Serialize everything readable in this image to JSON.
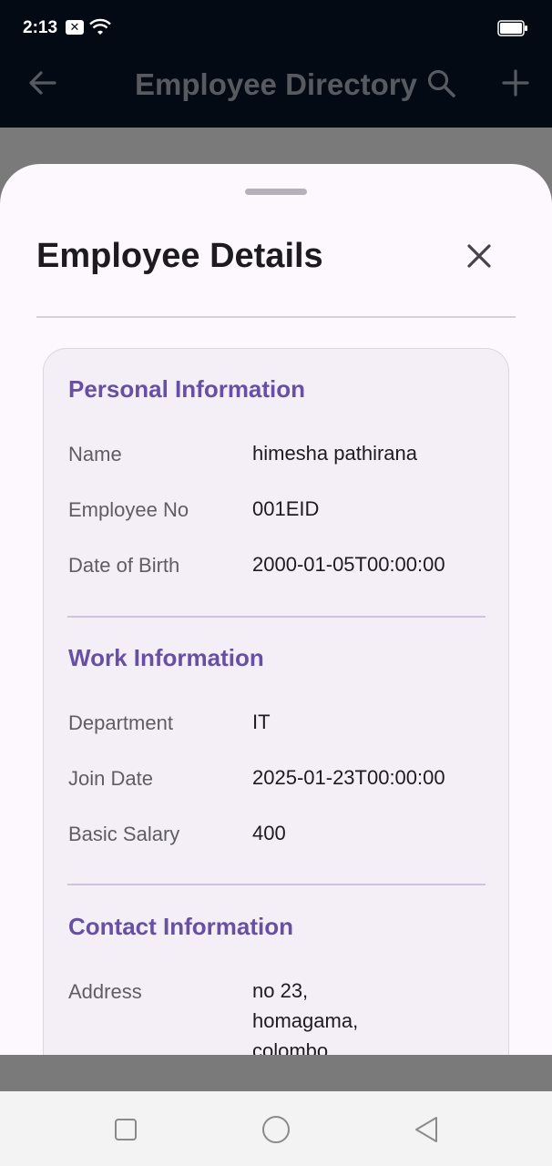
{
  "status_bar": {
    "time": "2:13",
    "notification_glyph": "✕"
  },
  "app_bar": {
    "title": "Employee Directory",
    "back_icon": "arrow-left",
    "search_icon": "search",
    "add_icon": "plus"
  },
  "sheet": {
    "title": "Employee Details",
    "close_icon": "close",
    "sections": [
      {
        "title": "Personal Information",
        "rows": [
          {
            "label": "Name",
            "value": "himesha pathirana"
          },
          {
            "label": "Employee No",
            "value": "001EID"
          },
          {
            "label": "Date of Birth",
            "value": "2000-01-05T00:00:00"
          }
        ]
      },
      {
        "title": "Work Information",
        "rows": [
          {
            "label": "Department",
            "value": "IT"
          },
          {
            "label": "Join Date",
            "value": "2025-01-23T00:00:00"
          },
          {
            "label": "Basic Salary",
            "value": "400"
          }
        ]
      },
      {
        "title": "Contact Information",
        "rows": [
          {
            "label": "Address",
            "value_lines": [
              "no 23,",
              "homagama,",
              "colombo"
            ]
          }
        ]
      }
    ]
  },
  "colors": {
    "accent": "#6750a4",
    "sheet_bg": "#fdf7fe",
    "card_bg": "#f4eff6",
    "app_bar_bg": "#030a14"
  }
}
